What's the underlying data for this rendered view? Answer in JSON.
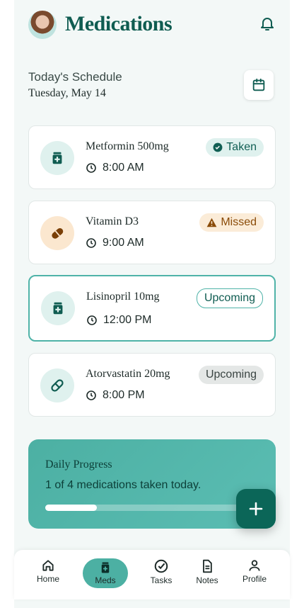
{
  "header": {
    "title": "Medications"
  },
  "schedule": {
    "label": "Today's Schedule",
    "date": "Tuesday, May 14"
  },
  "medications": [
    {
      "name": "Metformin 500mg",
      "time": "8:00 AM",
      "status": "Taken",
      "icon": "pill-bottle-icon"
    },
    {
      "name": "Vitamin D3",
      "time": "9:00 AM",
      "status": "Missed",
      "icon": "capsule-icon"
    },
    {
      "name": "Lisinopril 10mg",
      "time": "12:00 PM",
      "status": "Upcoming",
      "icon": "pill-bottle-icon"
    },
    {
      "name": "Atorvastatin 20mg",
      "time": "8:00 PM",
      "status": "Upcoming",
      "icon": "pill-icon"
    }
  ],
  "progress": {
    "title": "Daily Progress",
    "text": "1 of 4 medications taken today.",
    "fraction": 0.25
  },
  "nav": {
    "items": [
      {
        "label": "Home",
        "icon": "home-icon"
      },
      {
        "label": "Meds",
        "icon": "med-kit-icon",
        "active": true
      },
      {
        "label": "Tasks",
        "icon": "check-circle-icon"
      },
      {
        "label": "Notes",
        "icon": "document-icon"
      },
      {
        "label": "Profile",
        "icon": "person-icon"
      }
    ]
  },
  "colors": {
    "brand": "#0f5c51",
    "accent": "#4cb0a3",
    "taken": "#dff1ee",
    "missed": "#fbecd8"
  }
}
